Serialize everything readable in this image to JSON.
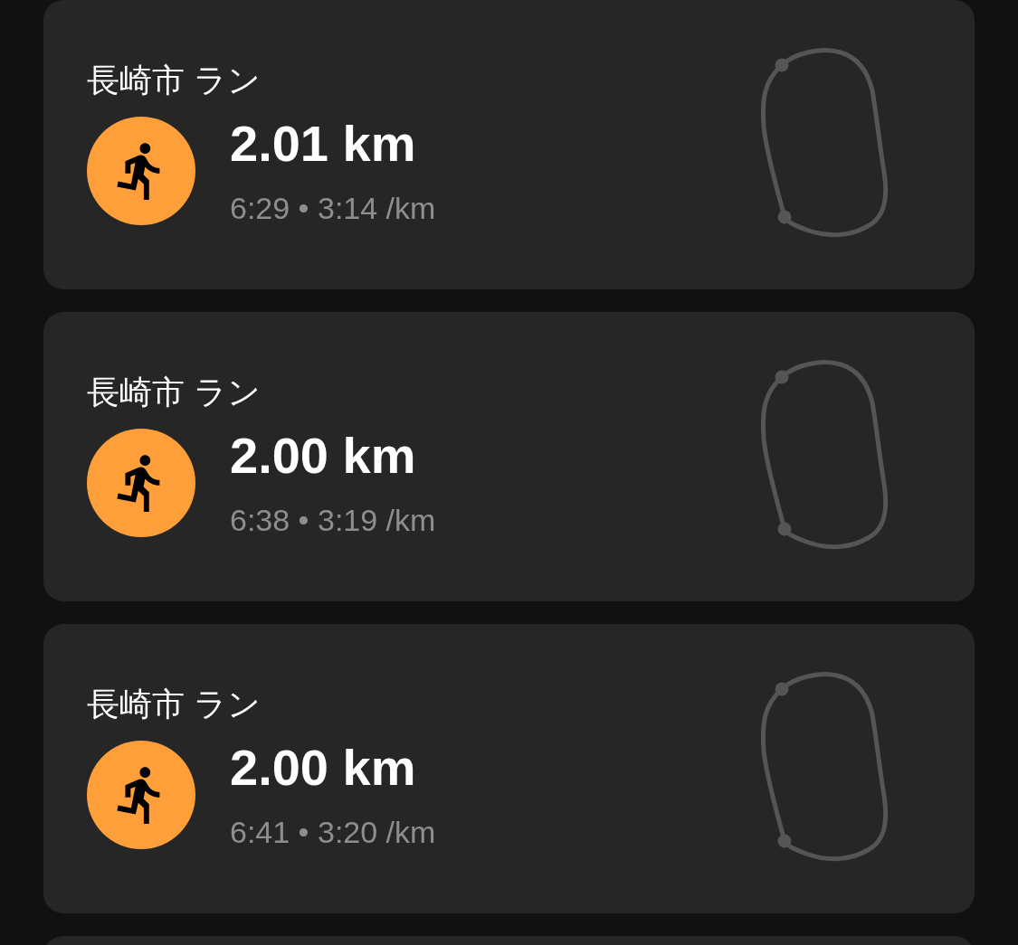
{
  "activities": [
    {
      "title": "長崎市 ラン",
      "distance": "2.01 km",
      "summary": "6:29 • 3:14 /km"
    },
    {
      "title": "長崎市 ラン",
      "distance": "2.00 km",
      "summary": "6:38 • 3:19 /km"
    },
    {
      "title": "長崎市 ラン",
      "distance": "2.00 km",
      "summary": "6:41 • 3:20 /km"
    }
  ]
}
